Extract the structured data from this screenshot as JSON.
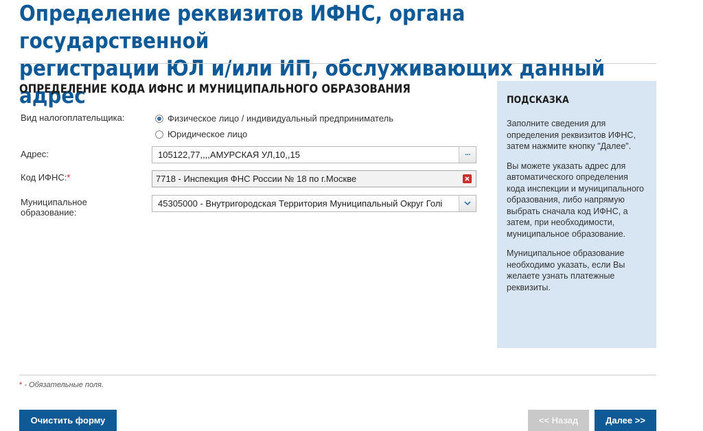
{
  "page": {
    "title_line1": "Определение реквизитов ИФНС, органа государственной",
    "title_line2": "регистрации ЮЛ и/или ИП, обслуживающих данный адрес"
  },
  "section": {
    "title": "ОПРЕДЕЛЕНИЕ КОДА ИФНС И МУНИЦИПАЛЬНОГО ОБРАЗОВАНИЯ"
  },
  "form": {
    "taxpayer_label": "Вид налогоплательщика:",
    "taxpayer_options": [
      {
        "label": "Физическое лицо / индивидуальный предприниматель",
        "selected": true
      },
      {
        "label": "Юридическое лицо",
        "selected": false
      }
    ],
    "address_label": "Адрес:",
    "address_value": "105122,77,,,,АМУРСКАЯ УЛ,10,,15",
    "address_button": "···",
    "ifns_label": "Код ИФНС:",
    "required_mark": "*",
    "ifns_value": "7718 - Инспекция ФНС России № 18 по г.Москве",
    "mo_label_line1": "Муниципальное",
    "mo_label_line2": "образование:",
    "mo_value": "45305000 - Внутригородская Территория Муниципальный Округ Голі"
  },
  "hint": {
    "title": "ПОДСКАЗКА",
    "paragraphs": [
      "Заполните сведения для определения реквизитов ИФНС, затем нажмите кнопку \"Далее\".",
      "Вы можете указать адрес для автоматического определения кода инспекции и муниципального образования, либо напрямую выбрать сначала код ИФНС, а затем, при необходимости, муниципальное образование.",
      "Муниципальное образование необходимо указать, если Вы желаете узнать платежные реквизиты."
    ]
  },
  "footer": {
    "required_star": "*",
    "required_note": " - Обязательные поля.",
    "clear_button": "Очистить форму",
    "back_button": "<< Назад",
    "next_button": "Далее >>"
  },
  "colors": {
    "brand": "#0f5a96",
    "hint_bg": "#d8e6f3",
    "required": "#d02020",
    "disabled": "#c9c9c9"
  }
}
